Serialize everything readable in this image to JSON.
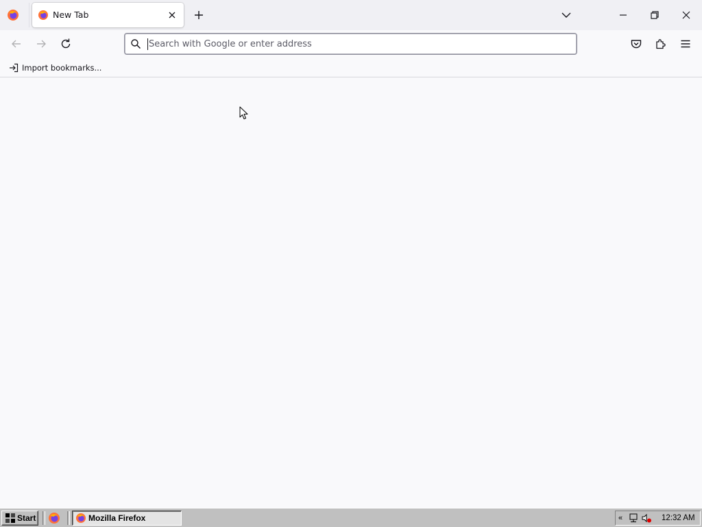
{
  "colors": {
    "toolbar_bg": "#f9f9fb",
    "tabstrip_bg": "#f0f0f4",
    "taskbar_bg": "#c0c0c0",
    "firefox_orange": "#ff7139",
    "firefox_purple": "#7542e5"
  },
  "tabs": [
    {
      "title": "New Tab",
      "icon": "firefox-icon",
      "selected": true
    }
  ],
  "toolbar": {
    "back_icon": "back-arrow-icon",
    "forward_icon": "forward-arrow-icon",
    "reload_icon": "reload-icon",
    "pocket_icon": "pocket-icon",
    "extensions_icon": "puzzle-icon",
    "menu_icon": "hamburger-menu-icon"
  },
  "urlbar": {
    "placeholder": "Search with Google or enter address",
    "value": ""
  },
  "bookmarks": {
    "import_label": "Import bookmarks..."
  },
  "taskbar": {
    "start_label": "Start",
    "tasks": [
      {
        "label": "Mozilla Firefox",
        "active": true
      }
    ],
    "tray_chevron": "«",
    "clock": "12:32 AM"
  }
}
